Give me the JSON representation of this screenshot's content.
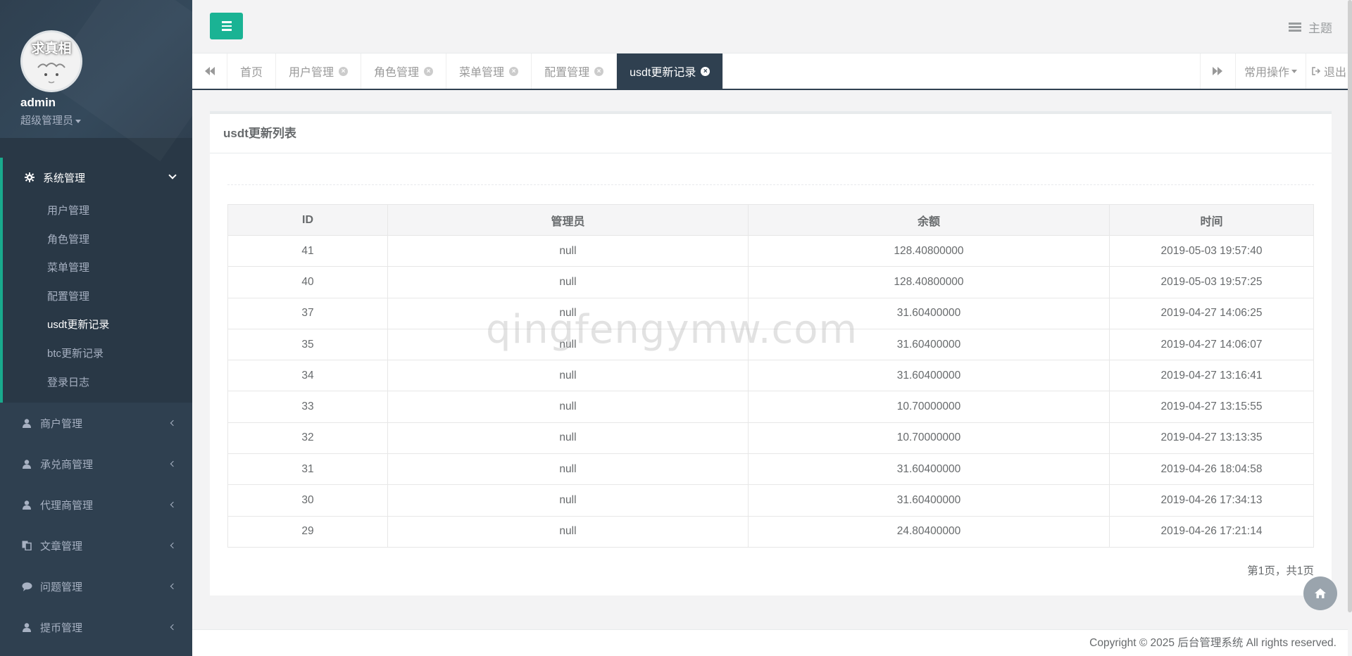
{
  "profile": {
    "avatar_text": "求真相",
    "name": "admin",
    "role": "超级管理员"
  },
  "sidebar": {
    "active_group": {
      "label": "系统管理",
      "icon": "gear-icon"
    },
    "sub_items": [
      {
        "label": "用户管理"
      },
      {
        "label": "角色管理"
      },
      {
        "label": "菜单管理"
      },
      {
        "label": "配置管理"
      },
      {
        "label": "usdt更新记录"
      },
      {
        "label": "btc更新记录"
      },
      {
        "label": "登录日志"
      }
    ],
    "groups": [
      {
        "label": "商户管理",
        "icon": "user-icon"
      },
      {
        "label": "承兑商管理",
        "icon": "user-icon"
      },
      {
        "label": "代理商管理",
        "icon": "user-icon"
      },
      {
        "label": "文章管理",
        "icon": "copy-icon"
      },
      {
        "label": "问题管理",
        "icon": "comment-icon"
      },
      {
        "label": "提币管理",
        "icon": "user-icon"
      }
    ]
  },
  "topbar": {
    "theme_label": "主题"
  },
  "tabs": {
    "items": [
      {
        "label": "首页"
      },
      {
        "label": "用户管理"
      },
      {
        "label": "角色管理"
      },
      {
        "label": "菜单管理"
      },
      {
        "label": "配置管理"
      },
      {
        "label": "usdt更新记录"
      }
    ],
    "actions_label": "常用操作",
    "logout_label": "退出"
  },
  "panel": {
    "title": "usdt更新列表",
    "columns": [
      "ID",
      "管理员",
      "余额",
      "时间"
    ],
    "rows": [
      [
        "41",
        "null",
        "128.40800000",
        "2019-05-03 19:57:40"
      ],
      [
        "40",
        "null",
        "128.40800000",
        "2019-05-03 19:57:25"
      ],
      [
        "37",
        "null",
        "31.60400000",
        "2019-04-27 14:06:25"
      ],
      [
        "35",
        "null",
        "31.60400000",
        "2019-04-27 14:06:07"
      ],
      [
        "34",
        "null",
        "31.60400000",
        "2019-04-27 13:16:41"
      ],
      [
        "33",
        "null",
        "10.70000000",
        "2019-04-27 13:15:55"
      ],
      [
        "32",
        "null",
        "10.70000000",
        "2019-04-27 13:13:35"
      ],
      [
        "31",
        "null",
        "31.60400000",
        "2019-04-26 18:04:58"
      ],
      [
        "30",
        "null",
        "31.60400000",
        "2019-04-26 17:34:13"
      ],
      [
        "29",
        "null",
        "24.80400000",
        "2019-04-26 17:21:14"
      ]
    ],
    "pagination": "第1页，共1页"
  },
  "watermark": "qingfengymw.com",
  "footer": {
    "copyright": "Copyright © 2025 后台管理系统 All rights reserved."
  },
  "colors": {
    "sidebar": "#2f4050",
    "accent": "#1ab394",
    "active_border": "#19aa8d"
  }
}
